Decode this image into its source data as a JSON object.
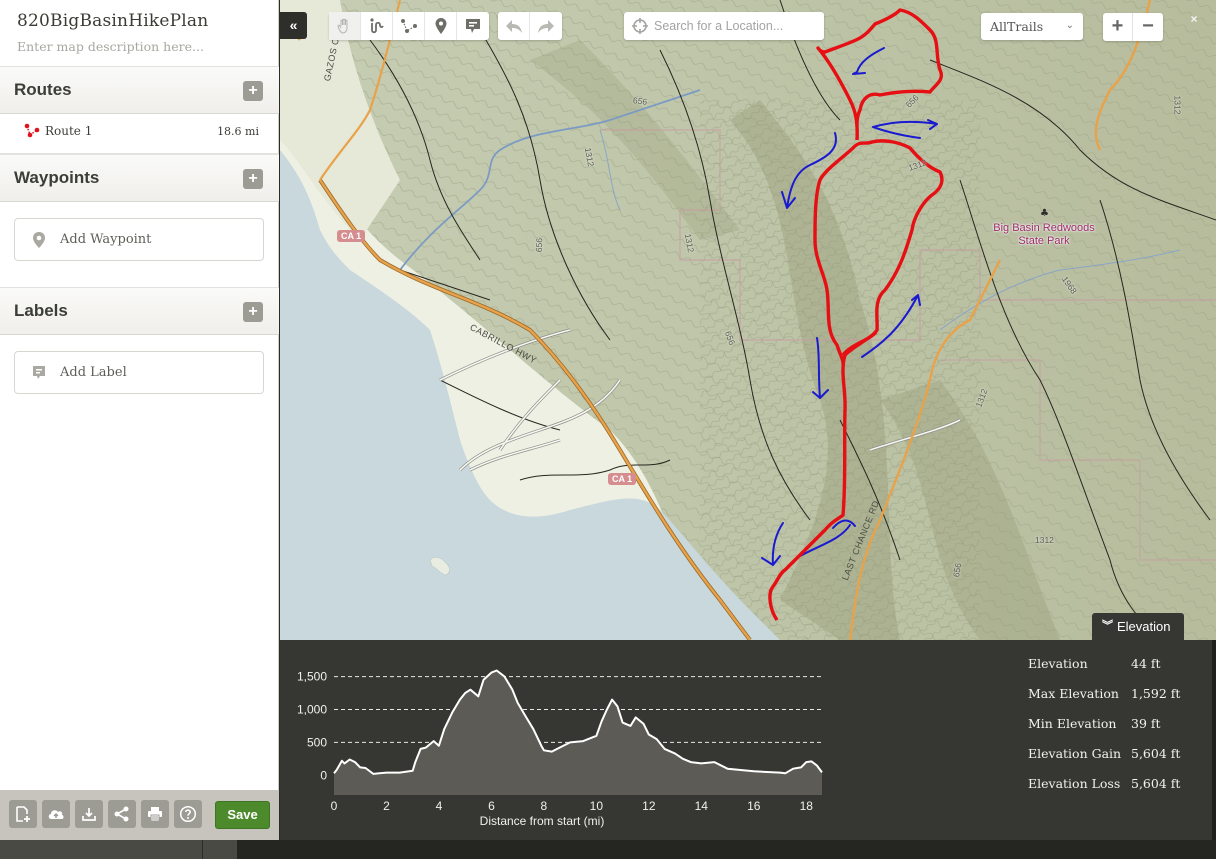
{
  "map_info": {
    "title": "820BigBasinHikePlan",
    "description_placeholder": "Enter map description here..."
  },
  "sidebar": {
    "routes": {
      "title": "Routes",
      "items": [
        {
          "name": "Route 1",
          "length": "18.6 mi",
          "icon": "route-icon",
          "color": "#e0131b"
        }
      ]
    },
    "waypoints": {
      "title": "Waypoints",
      "add_label": "Add Waypoint",
      "icon": "map-pin-icon"
    },
    "labels": {
      "title": "Labels",
      "add_label": "Add Label",
      "icon": "comment-icon"
    },
    "add_symbol": "+"
  },
  "bottom_toolbar": {
    "buttons": [
      {
        "name": "new-map",
        "icon": "new-file-icon"
      },
      {
        "name": "upload",
        "icon": "cloud-upload-icon"
      },
      {
        "name": "download",
        "icon": "download-icon"
      },
      {
        "name": "share",
        "icon": "share-icon"
      },
      {
        "name": "print",
        "icon": "print-icon"
      },
      {
        "name": "help",
        "icon": "help-icon"
      }
    ],
    "save_label": "Save",
    "save_color": "#4d8a2c"
  },
  "map_toolbar": {
    "collapse_symbol": "«",
    "tools": [
      {
        "name": "pan",
        "icon": "hand-icon",
        "active": true
      },
      {
        "name": "draw-freehand",
        "icon": "freehand-route-icon",
        "active": false
      },
      {
        "name": "draw-route",
        "icon": "route-points-icon",
        "active": false
      },
      {
        "name": "add-waypoint",
        "icon": "map-pin-icon",
        "active": false
      },
      {
        "name": "add-label",
        "icon": "comment-icon",
        "active": false
      }
    ],
    "history": [
      {
        "name": "undo",
        "icon": "undo-icon"
      },
      {
        "name": "redo",
        "icon": "redo-icon"
      }
    ],
    "search_placeholder": "Search for a Location...",
    "search_value": "",
    "layer_selected": "AllTrails",
    "zoom_in": "+",
    "zoom_out": "−",
    "close_symbol": "×"
  },
  "map_labels": {
    "park": "Big Basin Redwoods State Park",
    "highway_shield": "CA 1",
    "highway_name": "CABRILLO HWY",
    "road_last_chance": "LAST CHANCE RD",
    "creek": "GAZOS CR",
    "contours": [
      "656",
      "1312",
      "1968"
    ]
  },
  "map_colors": {
    "route": "#e60f14",
    "annotations": "#1a1ad0",
    "highway": "#e79a33",
    "water": "#c8d8dc",
    "park_label": "#9c2b6c"
  },
  "elevation_panel": {
    "tab_label": "Elevation",
    "tab_icon": "chevron-double-down-icon",
    "stats": [
      {
        "label": "Elevation",
        "value": "44 ft"
      },
      {
        "label": "Max Elevation",
        "value": "1,592 ft"
      },
      {
        "label": "Min Elevation",
        "value": "39 ft"
      },
      {
        "label": "Elevation Gain",
        "value": "5,604 ft"
      },
      {
        "label": "Elevation Loss",
        "value": "5,604 ft"
      }
    ]
  },
  "chart_data": {
    "type": "area",
    "title": "",
    "xlabel": "Distance from start (mi)",
    "ylabel": "",
    "xlim": [
      0,
      18.6
    ],
    "ylim": [
      -300,
      1600
    ],
    "x_ticks": [
      0,
      2,
      4,
      6,
      8,
      10,
      12,
      14,
      16,
      18
    ],
    "y_ticks": [
      0,
      500,
      1000,
      1500
    ],
    "y_tick_labels": [
      "0",
      "500",
      "1,000",
      "1,500"
    ],
    "grid": "horizontal-dashed",
    "series": [
      {
        "name": "Elevation (ft)",
        "x": [
          0,
          0.1,
          0.3,
          0.4,
          0.6,
          0.8,
          1.0,
          1.2,
          1.5,
          2.0,
          2.5,
          3.0,
          3.1,
          3.3,
          3.5,
          3.8,
          4.0,
          4.2,
          4.5,
          4.8,
          5.0,
          5.2,
          5.5,
          5.7,
          6.0,
          6.2,
          6.5,
          6.8,
          7.0,
          7.3,
          7.6,
          7.9,
          8.0,
          8.3,
          8.6,
          9.0,
          9.5,
          10.0,
          10.2,
          10.4,
          10.6,
          10.8,
          11.0,
          11.3,
          11.5,
          11.8,
          12.0,
          12.3,
          12.6,
          13.0,
          13.3,
          13.6,
          14.0,
          14.5,
          15.0,
          15.5,
          16.0,
          16.5,
          17.0,
          17.2,
          17.5,
          17.8,
          18.0,
          18.2,
          18.4,
          18.6
        ],
        "y": [
          30,
          80,
          220,
          180,
          240,
          200,
          120,
          110,
          20,
          40,
          40,
          70,
          200,
          400,
          420,
          520,
          450,
          700,
          950,
          1150,
          1250,
          1300,
          1200,
          1450,
          1560,
          1592,
          1500,
          1300,
          1100,
          900,
          700,
          450,
          380,
          360,
          420,
          500,
          520,
          600,
          820,
          1000,
          1150,
          1050,
          800,
          750,
          880,
          780,
          620,
          550,
          400,
          330,
          250,
          200,
          180,
          200,
          100,
          80,
          60,
          50,
          40,
          30,
          100,
          120,
          200,
          210,
          150,
          44
        ]
      }
    ]
  }
}
